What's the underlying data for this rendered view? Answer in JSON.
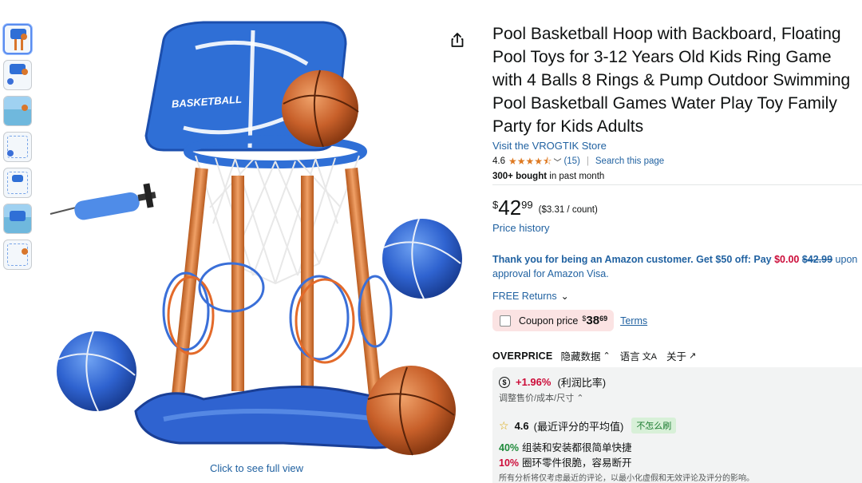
{
  "thumbnails": [
    "thumb-1",
    "thumb-2",
    "thumb-3",
    "thumb-4",
    "thumb-5",
    "thumb-6",
    "thumb-7"
  ],
  "image": {
    "board_text": "BASKETBALL",
    "full_view_label": "Click to see full view"
  },
  "product": {
    "title": "Pool Basketball Hoop with Backboard, Floating Pool Toys for 3-12 Years Old Kids Ring Game with 4 Balls 8 Rings & Pump Outdoor Swimming Pool Basketball Games Water Play Toy Family Party for Kids Adults",
    "store_link": "Visit the VROGTIK Store",
    "rating": "4.6",
    "rating_value": 4.6,
    "rating_count": "(15)",
    "search_page": "Search this page",
    "bought_bold": "300+ bought",
    "bought_rest": " in past month"
  },
  "price": {
    "currency": "$",
    "whole": "42",
    "fraction": "99",
    "unit_price": "($3.31 / count)",
    "history_label": "Price history"
  },
  "promo": {
    "part1": "Thank you for being an Amazon customer. Get $50 off: Pay ",
    "pay": "$0.00",
    "space": " ",
    "was": "$42.99",
    "part2": " upon approval for Amazon Visa."
  },
  "returns": {
    "label": "FREE Returns"
  },
  "coupon": {
    "label": "Coupon price",
    "currency": "$",
    "whole": "38",
    "fraction": "69",
    "terms": "Terms"
  },
  "extension": {
    "brand": "OVERPRICE",
    "hide_data": "隐藏数据",
    "language": "语言",
    "about": "关于"
  },
  "panel": {
    "profit_pct": "+1.96%",
    "profit_label": "(利润比率)",
    "adjust_label": "调整售价/成本/尺寸",
    "avg_rating": "4.6",
    "avg_rating_label": "(最近评分的平均值)",
    "badge": "不怎么刷",
    "line1_pct": "40%",
    "line1_text": "组装和安装都很简单快捷",
    "line2_pct": "10%",
    "line2_text": "圈环零件很脆，容易断开",
    "footer": "所有分析将仅考虑最近的评论，以最小化虚假和无效评论及评分的影响。"
  },
  "colors": {
    "link": "#2162a1",
    "star": "#de7921",
    "price_red": "#cc0c39",
    "hoop_blue": "#2f6fd6",
    "pole_orange": "#d9762b"
  }
}
